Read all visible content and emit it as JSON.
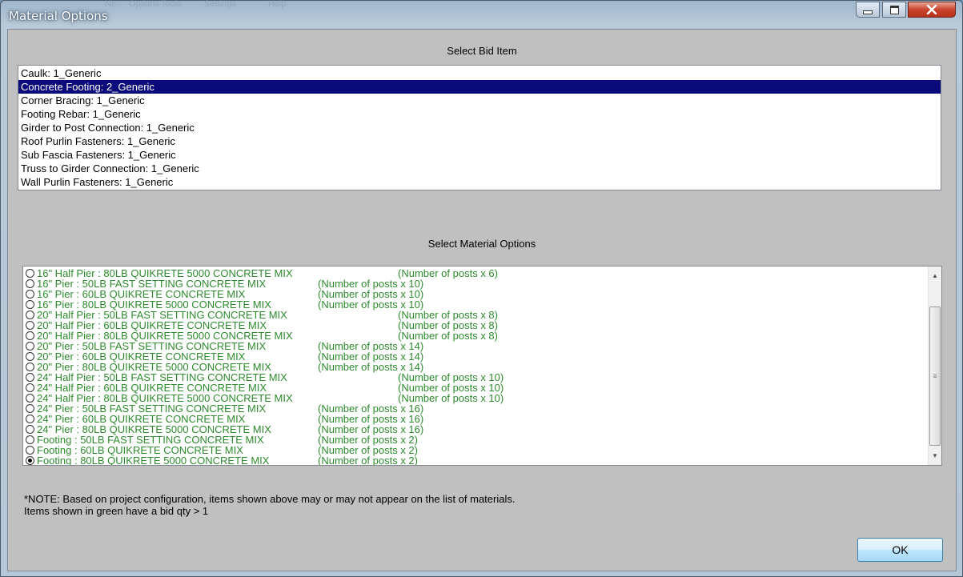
{
  "window": {
    "title": "Material Options",
    "ghost_menu": [
      "Ne",
      "Options",
      "Tools",
      "Settings",
      "Help"
    ],
    "minimize_glyph": "▁",
    "maximize_glyph": "▢",
    "close_glyph": "✕"
  },
  "bid_section": {
    "title": "Select Bid Item",
    "items": [
      {
        "label": "Caulk: 1_Generic",
        "selected": false
      },
      {
        "label": "Concrete Footing: 2_Generic",
        "selected": true
      },
      {
        "label": "Corner Bracing: 1_Generic",
        "selected": false
      },
      {
        "label": "Footing Rebar: 1_Generic",
        "selected": false
      },
      {
        "label": "Girder to Post Connection: 1_Generic",
        "selected": false
      },
      {
        "label": "Roof Purlin Fasteners: 1_Generic",
        "selected": false
      },
      {
        "label": "Sub Fascia Fasteners: 1_Generic",
        "selected": false
      },
      {
        "label": "Truss to Girder Connection: 1_Generic",
        "selected": false
      },
      {
        "label": "Wall Purlin Fasteners: 1_Generic",
        "selected": false
      }
    ]
  },
  "material_section": {
    "title": "Select Material Options",
    "options": [
      {
        "name": "16\" Half Pier : 80LB QUIKRETE 5000 CONCRETE MIX",
        "qty": "(Number of posts x 6)",
        "checked": false,
        "qty_col": "wide"
      },
      {
        "name": "16\" Pier : 50LB FAST SETTING CONCRETE MIX",
        "qty": "(Number of posts x 10)",
        "checked": false,
        "qty_col": "narrow"
      },
      {
        "name": "16\" Pier : 60LB QUIKRETE CONCRETE MIX",
        "qty": "(Number of posts x 10)",
        "checked": false,
        "qty_col": "narrow"
      },
      {
        "name": "16\" Pier : 80LB QUIKRETE 5000 CONCRETE MIX",
        "qty": "(Number of posts x 10)",
        "checked": false,
        "qty_col": "narrow"
      },
      {
        "name": "20\" Half Pier : 50LB FAST SETTING CONCRETE MIX",
        "qty": "(Number of posts x 8)",
        "checked": false,
        "qty_col": "wide"
      },
      {
        "name": "20\" Half Pier : 60LB QUIKRETE CONCRETE MIX",
        "qty": "(Number of posts x 8)",
        "checked": false,
        "qty_col": "wide"
      },
      {
        "name": "20\" Half Pier : 80LB QUIKRETE 5000 CONCRETE MIX",
        "qty": "(Number of posts x 8)",
        "checked": false,
        "qty_col": "wide"
      },
      {
        "name": "20\" Pier : 50LB FAST SETTING CONCRETE MIX",
        "qty": "(Number of posts x 14)",
        "checked": false,
        "qty_col": "narrow"
      },
      {
        "name": "20\" Pier : 60LB QUIKRETE CONCRETE MIX",
        "qty": "(Number of posts x 14)",
        "checked": false,
        "qty_col": "narrow"
      },
      {
        "name": "20\" Pier : 80LB QUIKRETE 5000 CONCRETE MIX",
        "qty": "(Number of posts x 14)",
        "checked": false,
        "qty_col": "narrow"
      },
      {
        "name": "24\" Half Pier : 50LB FAST SETTING CONCRETE MIX",
        "qty": "(Number of posts x 10)",
        "checked": false,
        "qty_col": "wide"
      },
      {
        "name": "24\" Half Pier : 60LB QUIKRETE CONCRETE MIX",
        "qty": "(Number of posts x 10)",
        "checked": false,
        "qty_col": "wide"
      },
      {
        "name": "24\" Half Pier : 80LB QUIKRETE 5000 CONCRETE MIX",
        "qty": "(Number of posts x 10)",
        "checked": false,
        "qty_col": "wide"
      },
      {
        "name": "24\" Pier : 50LB FAST SETTING CONCRETE MIX",
        "qty": "(Number of posts x 16)",
        "checked": false,
        "qty_col": "narrow"
      },
      {
        "name": "24\" Pier : 60LB QUIKRETE CONCRETE MIX",
        "qty": "(Number of posts x 16)",
        "checked": false,
        "qty_col": "narrow"
      },
      {
        "name": "24\" Pier : 80LB QUIKRETE 5000 CONCRETE MIX",
        "qty": "(Number of posts x 16)",
        "checked": false,
        "qty_col": "narrow"
      },
      {
        "name": "Footing : 50LB FAST SETTING CONCRETE MIX",
        "qty": "(Number of posts x 2)",
        "checked": false,
        "qty_col": "narrow"
      },
      {
        "name": "Footing : 60LB QUIKRETE CONCRETE MIX",
        "qty": "(Number of posts x 2)",
        "checked": false,
        "qty_col": "narrow"
      },
      {
        "name": "Footing : 80LB QUIKRETE 5000 CONCRETE MIX",
        "qty": "(Number of posts x 2)",
        "checked": true,
        "qty_col": "narrow"
      }
    ],
    "scroll_up_glyph": "▲",
    "scroll_down_glyph": "▼",
    "scroll_grip_glyph": "≡"
  },
  "note": {
    "line1": "*NOTE:  Based on project configuration, items shown above may or may not appear on the list of materials.",
    "line2": "Items shown in green have a bid qty > 1"
  },
  "ok_button": {
    "label": "OK"
  },
  "colors": {
    "selection_bg": "#0a0a7a",
    "option_text": "#2d8b2d",
    "dialog_bg": "#c0c0c0"
  }
}
